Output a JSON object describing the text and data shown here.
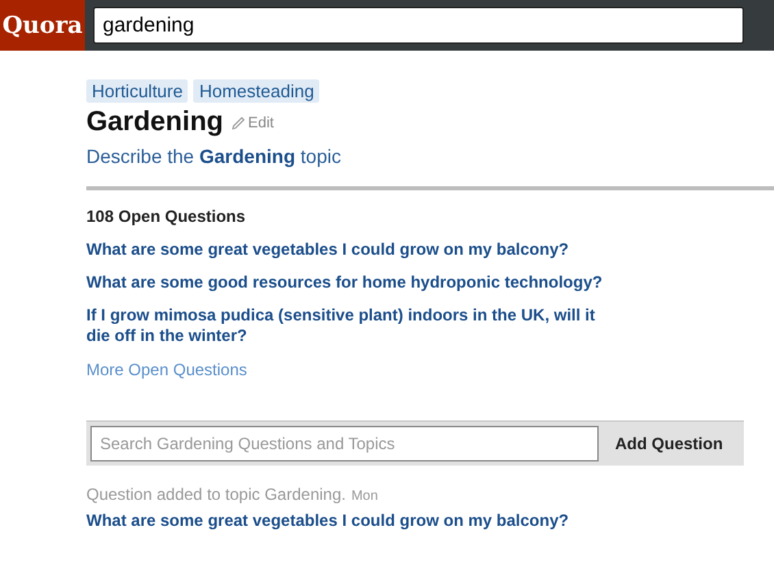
{
  "header": {
    "logo": "Quora",
    "search_value": "gardening"
  },
  "topic": {
    "tags": [
      "Horticulture",
      "Homesteading"
    ],
    "title": "Gardening",
    "edit_label": "Edit",
    "description": "Describe the **Gardening** topic"
  },
  "open_questions": {
    "heading": "108 Open Questions",
    "questions": [
      "What are some great vegetables I could grow on my balcony?",
      "What are some good resources for home hydroponic technology?",
      "If I grow mimosa pudica (sensitive plant) indoors in the UK, will it die off in the winter?"
    ],
    "more_link": "More Open Questions"
  },
  "question_bar": {
    "placeholder": "Search Gardening Questions and Topics",
    "button": "Add Question"
  },
  "feed": [
    {
      "activity": "Question added to topic Gardening.",
      "time": "Mon",
      "question": "What are some great vegetables I could grow on my balcony?"
    }
  ]
}
